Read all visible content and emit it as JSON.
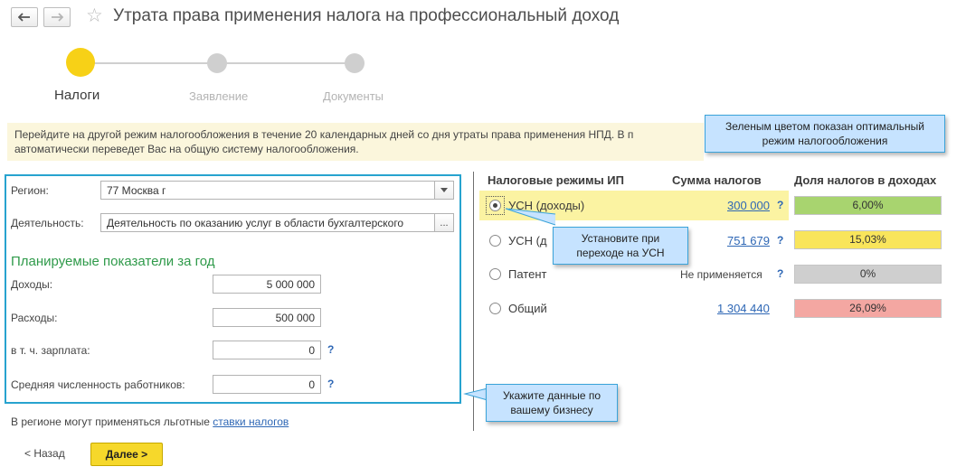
{
  "header": {
    "title": "Утрата права применения налога на профессиональный доход"
  },
  "stepper": {
    "steps": [
      {
        "label": "Налоги",
        "state": "active"
      },
      {
        "label": "Заявление",
        "state": "inactive"
      },
      {
        "label": "Документы",
        "state": "inactive"
      }
    ]
  },
  "info": {
    "line1": "Перейдите на другой режим налогообложения в течение 20 календарных дней со дня утраты права применения НПД. В п",
    "line2": "автоматически переведет Вас на общую систему налогообложения."
  },
  "tooltips": {
    "optimal": "Зеленым цветом показан оптимальный режим налогообложения",
    "choose": "Установите при переходе на УСН",
    "enter": "Укажите данные по вашему бизнесу"
  },
  "form": {
    "region_label": "Регион:",
    "region_value": "77 Москва г",
    "activity_label": "Деятельность:",
    "activity_value": "Деятельность по оказанию услуг в области бухгалтерского",
    "activity_btn": "...",
    "section_title": "Планируемые показатели за год",
    "income_label": "Доходы:",
    "income_value": "5 000 000",
    "expenses_label": "Расходы:",
    "expenses_value": "500 000",
    "salary_label": "в т. ч. зарплата:",
    "salary_value": "0",
    "employees_label": "Средняя численность работников:",
    "employees_value": "0",
    "help": "?",
    "region_note": "В регионе могут применяться льготные",
    "region_note_link": "ставки налогов"
  },
  "table": {
    "headers": {
      "mode": "Налоговые режимы ИП",
      "sum": "Сумма налогов",
      "share": "Доля налогов в доходах"
    },
    "rows": [
      {
        "mode": "УСН (доходы)",
        "sum": "300 000",
        "share": "6,00%",
        "color": "#a8d46f",
        "selected": true
      },
      {
        "mode": "УСН (д",
        "sum": "751 679",
        "share": "15,03%",
        "color": "#f9e55b",
        "selected": false
      },
      {
        "mode": "Патент",
        "sum": "Не применяется",
        "share": "0%",
        "color": "#cfcfcf",
        "selected": false
      },
      {
        "mode": "Общий",
        "sum": "1 304 440",
        "share": "26,09%",
        "color": "#f4a7a2",
        "selected": false
      }
    ]
  },
  "footer": {
    "back_label": "< Назад",
    "next_label": "Далее >"
  },
  "colors": {
    "accent": "#f7d117",
    "panel_border": "#27a3cf",
    "section_green": "#2f9a4a",
    "link": "#2e67b5"
  }
}
